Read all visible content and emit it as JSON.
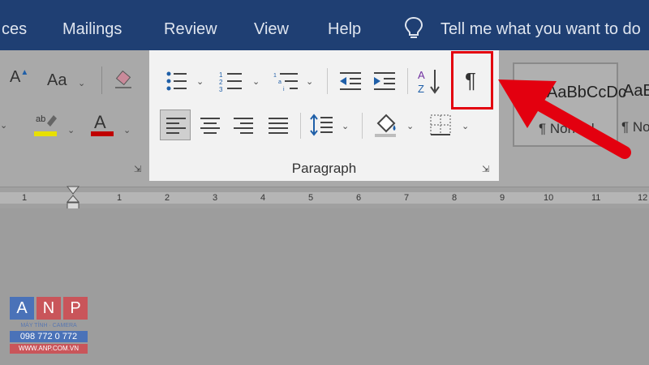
{
  "tabs": [
    {
      "label": "ces"
    },
    {
      "label": "Mailings"
    },
    {
      "label": "Review"
    },
    {
      "label": "View"
    },
    {
      "label": "Help"
    }
  ],
  "tell_me": {
    "text": "Tell me what you want to do"
  },
  "font_group": {
    "font_size_label": "Aa",
    "change_case_label": "Aa"
  },
  "paragraph_group": {
    "label": "Paragraph",
    "pilcrow": "¶"
  },
  "styles": {
    "normal_preview": "AaBbCcDc",
    "normal_label": "¶ Normal",
    "next_preview": "AaB",
    "next_label": "¶ No"
  },
  "ruler": {
    "labels": [
      "1",
      "1",
      "2",
      "3",
      "4",
      "5",
      "6",
      "7",
      "8",
      "9",
      "10",
      "11",
      "12"
    ]
  },
  "watermark": {
    "letters": [
      "A",
      "N",
      "P"
    ],
    "line1": "MÁY TÍNH · CAMERA",
    "phone": "098 772 0 772",
    "site": "WWW.ANP.COM.VN"
  },
  "colors": {
    "title_bar": "#1f3f73",
    "highlight_box": "#e3000f",
    "arrow": "#e3000f",
    "font_color_bar": "#c00000",
    "highlighter_bar": "#e8e000"
  }
}
